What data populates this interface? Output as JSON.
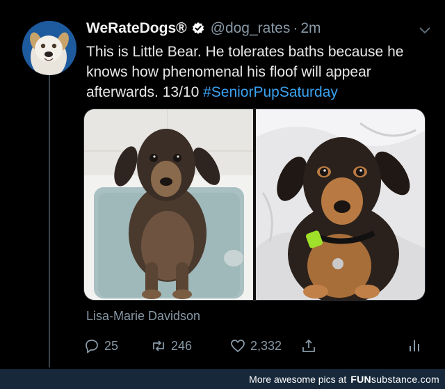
{
  "tweet": {
    "display_name": "WeRateDogs®",
    "handle": "@dog_rates",
    "separator": "·",
    "time": "2m",
    "text_plain": "This is Little Bear. He tolerates baths because he knows how phenomenal his floof will appear afterwards. 13/10 ",
    "hashtag": "#SeniorPupSaturday",
    "photo_credit": "Lisa-Marie Davidson"
  },
  "actions": {
    "reply_count": "25",
    "retweet_count": "246",
    "like_count": "2,332"
  },
  "footer": {
    "prefix": "More awesome pics at",
    "brand_bold": "FUN",
    "brand_thin": "substance",
    "brand_suffix": ".com"
  },
  "colors": {
    "background": "#000000",
    "muted": "#8899a6",
    "hashtag": "#3aa2f0",
    "verified": "#ffffff",
    "footer_bg": "#17283a"
  },
  "icons": [
    "verified-badge-icon",
    "chevron-down-icon",
    "reply-icon",
    "retweet-icon",
    "heart-icon",
    "share-icon",
    "analytics-icon"
  ]
}
